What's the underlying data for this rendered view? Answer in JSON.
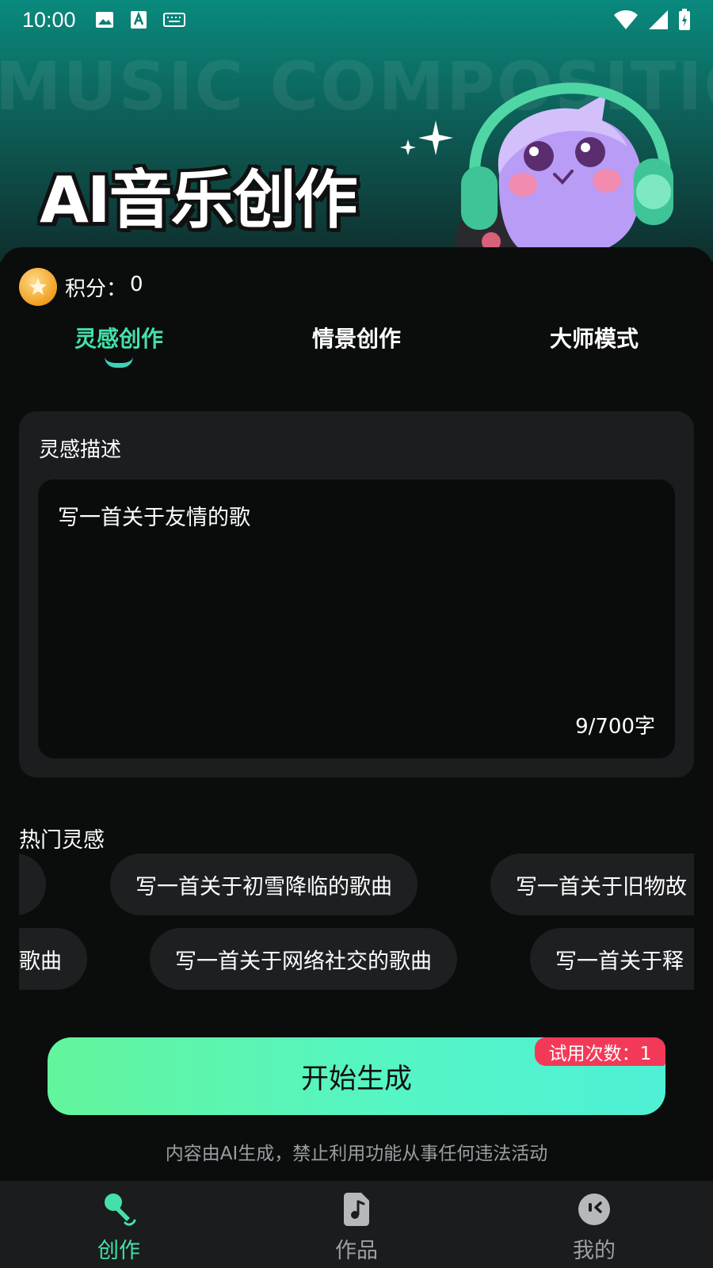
{
  "status_bar": {
    "time": "10:00"
  },
  "hero": {
    "watermark": "MUSIC COMPOSITION",
    "title": "AI音乐创作"
  },
  "points": {
    "label": "积分：",
    "value": "0"
  },
  "tabs": [
    {
      "label": "灵感创作",
      "active": true
    },
    {
      "label": "情景创作",
      "active": false
    },
    {
      "label": "大师模式",
      "active": false
    }
  ],
  "inspiration": {
    "label": "灵感描述",
    "text": "写一首关于友情的歌",
    "count": "9/700字"
  },
  "hot": {
    "title": "热门灵感",
    "row1": [
      "写一首关于初雪降临的歌曲",
      "写一首关于旧物故"
    ],
    "row2": [
      "歌曲",
      "写一首关于网络社交的歌曲",
      "写一首关于释"
    ]
  },
  "generate": {
    "label": "开始生成",
    "trial": "试用次数：1"
  },
  "disclaimer": "内容由AI生成，禁止利用功能从事任何违法活动",
  "nav": [
    {
      "label": "创作",
      "icon": "microphone-icon",
      "active": true
    },
    {
      "label": "作品",
      "icon": "music-note-icon",
      "active": false
    },
    {
      "label": "我的",
      "icon": "profile-face-icon",
      "active": false
    }
  ],
  "colors": {
    "accent": "#45e0a8",
    "badge": "#f23a58",
    "button_start": "#63f59c",
    "button_end": "#4ff0d6"
  }
}
